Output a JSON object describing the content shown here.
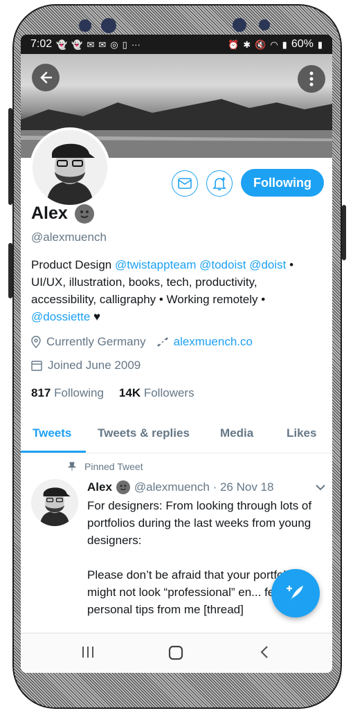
{
  "statusbar": {
    "time": "7:02",
    "battery": "60%",
    "left_icons": [
      "snapchat-icon",
      "snapchat-icon",
      "gmail-icon",
      "gmail-icon",
      "instagram-icon",
      "cup-icon",
      "more-dots"
    ],
    "right_icons": [
      "alarm-icon",
      "bluetooth-icon",
      "mute-icon",
      "wifi-icon",
      "signal-icon",
      "battery-icon"
    ]
  },
  "header": {
    "back_icon": "arrow-left-icon",
    "more_icon": "vertical-dots-icon"
  },
  "profile": {
    "name": "Alex",
    "handle": "@alexmuench",
    "follow_label": "Following",
    "bio_text1": "Product Design ",
    "bio_link1": "@twistappteam",
    "bio_link2": "@todoist",
    "bio_link3": "@doist",
    "bio_text2": " • UI/UX, illustration, books, tech, productivity, accessibility, calligraphy • Working remotely • ",
    "bio_link4": "@dossiette",
    "location": "Currently Germany",
    "website": "alexmuench.co",
    "joined": "Joined June 2009",
    "following_count": "817",
    "following_label": "Following",
    "followers_count": "14K",
    "followers_label": "Followers"
  },
  "tabs": [
    "Tweets",
    "Tweets & replies",
    "Media",
    "Likes"
  ],
  "tweet": {
    "pinned_label": "Pinned Tweet",
    "author": "Alex",
    "handle_date": "@alexmuench · 26 Nov 18",
    "body": "For designers: From looking through lots of portfolios during the last weeks from young designers:\n\nPlease don’t be afraid that your portfolio might not look “professional” en... few personal tips from me [thread]"
  },
  "colors": {
    "accent": "#1da1f2",
    "text": "#14171a",
    "secondary": "#657786"
  }
}
